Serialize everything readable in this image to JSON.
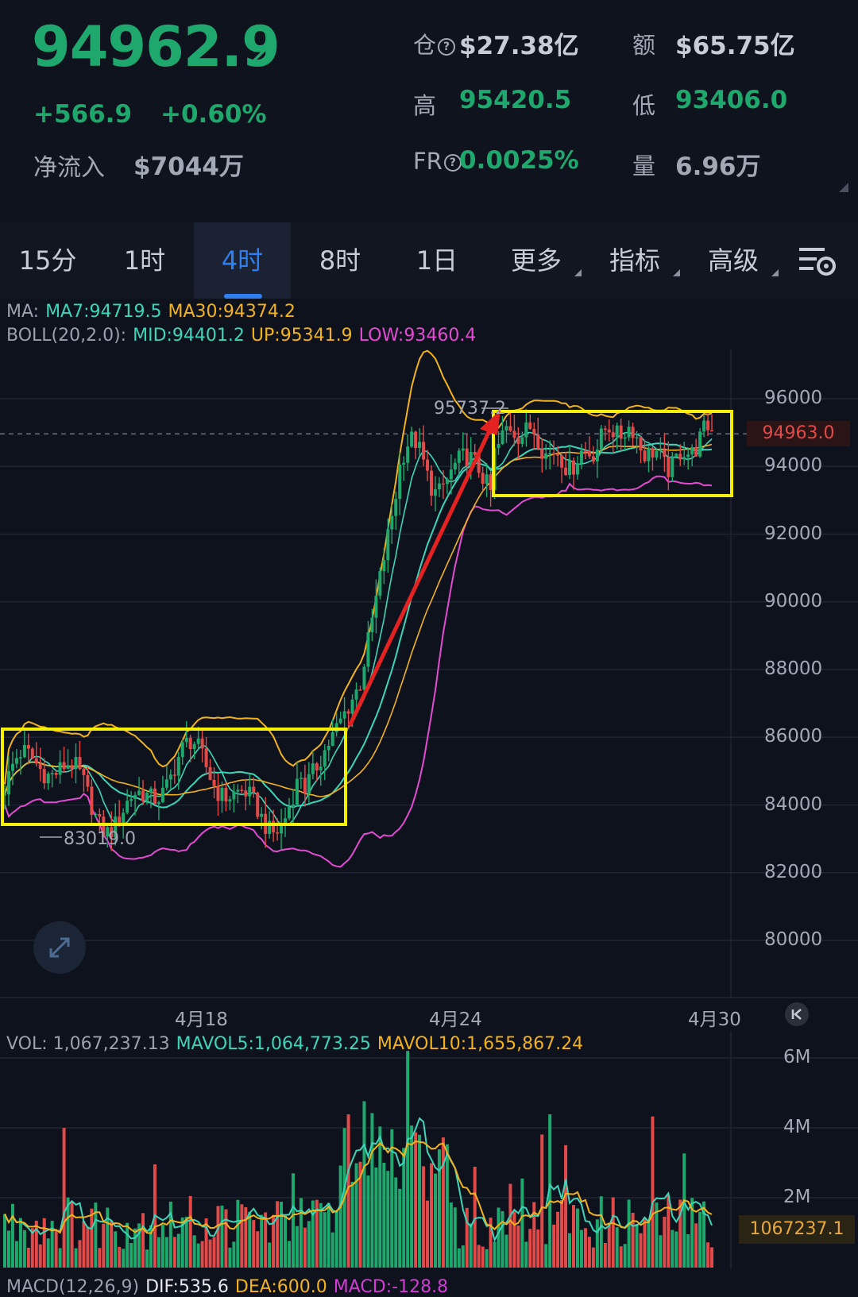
{
  "header": {
    "price": "94962.9",
    "change_abs": "+566.9",
    "change_pct": "+0.60%",
    "netflow_label": "净流入",
    "netflow_value": "$7044万",
    "open_interest_label": "仓",
    "open_interest_value": "$27.38亿",
    "turnover_label": "额",
    "turnover_value": "$65.75亿",
    "high_label": "高",
    "high_value": "95420.5",
    "low_label": "低",
    "low_value": "93406.0",
    "funding_label": "FR",
    "funding_value": "0.0025%",
    "volume_label": "量",
    "volume_value": "6.96万",
    "colors": {
      "up": "#1ea86e",
      "down": "#e24a4a"
    }
  },
  "tabs": {
    "items": [
      {
        "label": "15分"
      },
      {
        "label": "1时"
      },
      {
        "label": "4时"
      },
      {
        "label": "8时"
      },
      {
        "label": "1日"
      },
      {
        "label": "更多"
      },
      {
        "label": "指标"
      },
      {
        "label": "高级"
      }
    ],
    "active": "4时"
  },
  "legends": {
    "ma_prefix": "MA:",
    "ma7": "MA7:94719.5",
    "ma30": "MA30:94374.2",
    "boll_prefix": "BOLL(20,2.0):",
    "boll_mid": "MID:94401.2",
    "boll_up": "UP:95341.9",
    "boll_low": "LOW:93460.4",
    "vol_prefix": "VOL: 1,067,237.13",
    "mavol5": "MAVOL5:1,064,773.25",
    "mavol10": "MAVOL10:1,655,867.24",
    "macd_prefix": "MACD(12,26,9)",
    "dif": "DIF:535.6",
    "dea": "DEA:600.0",
    "macd": "MACD:-128.8"
  },
  "chart_data": {
    "type": "candlestick",
    "y_ticks": [
      "96000",
      "94000",
      "92000",
      "90000",
      "88000",
      "86000",
      "84000",
      "82000",
      "80000"
    ],
    "ylim": [
      79000,
      97000
    ],
    "x_ticks": [
      "4月18",
      "4月24",
      "4月30"
    ],
    "last_price_tag": "94963.0",
    "max_label": "95737.2",
    "min_label": "83019.0",
    "volume_ticks": [
      "6M",
      "4M",
      "2M"
    ],
    "volume_tag": "1067237.1"
  }
}
